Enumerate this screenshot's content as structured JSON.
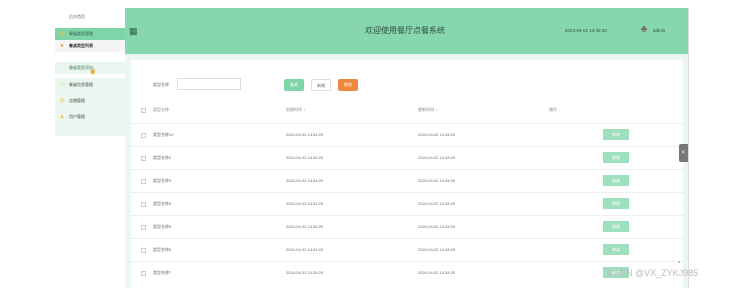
{
  "sidebar": {
    "home": "后台首页",
    "items": [
      {
        "label": "餐桌类型管理",
        "icon": "table-icon",
        "state": "active"
      },
      {
        "label": "餐桌类型列表",
        "icon": "pin-icon",
        "state": "open"
      },
      {
        "label": "餐桌类型添加",
        "icon": "",
        "state": "sub"
      },
      {
        "label": "餐桌信息管理",
        "icon": "folder-icon",
        "state": "normal"
      },
      {
        "label": "店铺管理",
        "icon": "store-icon",
        "state": "normal"
      },
      {
        "label": "用户管理",
        "icon": "user-icon",
        "state": "normal"
      }
    ]
  },
  "header": {
    "title": "欢迎使用餐厅点餐系统",
    "datetime": "2024-04-02 14:45:20",
    "username": "admin"
  },
  "search": {
    "label": "类型名称",
    "input_value": "",
    "query_label": "查询",
    "add_label": "新增",
    "delete_label": "删除"
  },
  "table": {
    "headers": {
      "name": "类型名称",
      "created": "创建时间 ↕",
      "updated": "更新时间 ↕",
      "actions": "操作"
    },
    "rows": [
      {
        "name": "类型名称12",
        "created": "2024-04-02 14:34:20",
        "updated": "2024-04-02 14:34:20",
        "action": "修改"
      },
      {
        "name": "类型名称2",
        "created": "2024-04-02 14:34:20",
        "updated": "2024-04-02 14:34:20",
        "action": "修改"
      },
      {
        "name": "类型名称3",
        "created": "2024-04-02 14:34:20",
        "updated": "2024-04-02 14:34:20",
        "action": "修改"
      },
      {
        "name": "类型名称4",
        "created": "2024-04-02 14:34:20",
        "updated": "2024-04-02 14:34:20",
        "action": "修改"
      },
      {
        "name": "类型名称5",
        "created": "2024-04-02 14:34:20",
        "updated": "2024-04-02 14:34:20",
        "action": "修改"
      },
      {
        "name": "类型名称6",
        "created": "2024-04-02 14:34:20",
        "updated": "2024-04-02 14:34:20",
        "action": "修改"
      },
      {
        "name": "类型名称7",
        "created": "2024-04-02 14:34:20",
        "updated": "2024-04-02 14:34:20",
        "action": "修改"
      }
    ]
  },
  "side_tab": "<",
  "watermark": "CSDN @VX_ZYKJ985",
  "colors": {
    "accent": "#86d6ae",
    "danger": "#f0883e",
    "row_button": "#9ee0bd"
  }
}
